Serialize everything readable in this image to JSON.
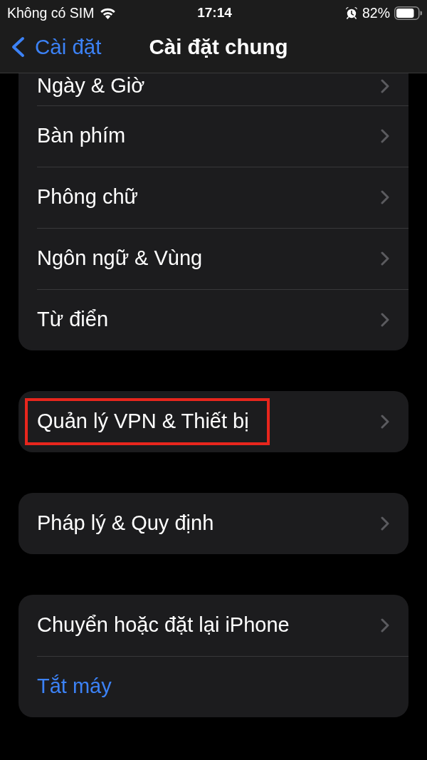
{
  "status_bar": {
    "carrier": "Không có SIM",
    "time": "17:14",
    "battery": "82%"
  },
  "nav_bar": {
    "back": "Cài đặt",
    "title": "Cài đặt chung"
  },
  "groups": [
    {
      "items": [
        {
          "label": "Ngày & Giờ",
          "kind": "disclosure",
          "highlighted": false
        },
        {
          "label": "Bàn phím",
          "kind": "disclosure",
          "highlighted": false
        },
        {
          "label": "Phông chữ",
          "kind": "disclosure",
          "highlighted": false
        },
        {
          "label": "Ngôn ngữ & Vùng",
          "kind": "disclosure",
          "highlighted": false
        },
        {
          "label": "Từ điển",
          "kind": "disclosure",
          "highlighted": false
        }
      ]
    },
    {
      "items": [
        {
          "label": "Quản lý VPN & Thiết bị",
          "kind": "disclosure",
          "highlighted": true
        }
      ]
    },
    {
      "items": [
        {
          "label": "Pháp lý & Quy định",
          "kind": "disclosure",
          "highlighted": false
        }
      ]
    },
    {
      "items": [
        {
          "label": "Chuyển hoặc đặt lại iPhone",
          "kind": "disclosure",
          "highlighted": false
        },
        {
          "label": "Tắt máy",
          "kind": "action",
          "highlighted": false
        }
      ]
    }
  ]
}
